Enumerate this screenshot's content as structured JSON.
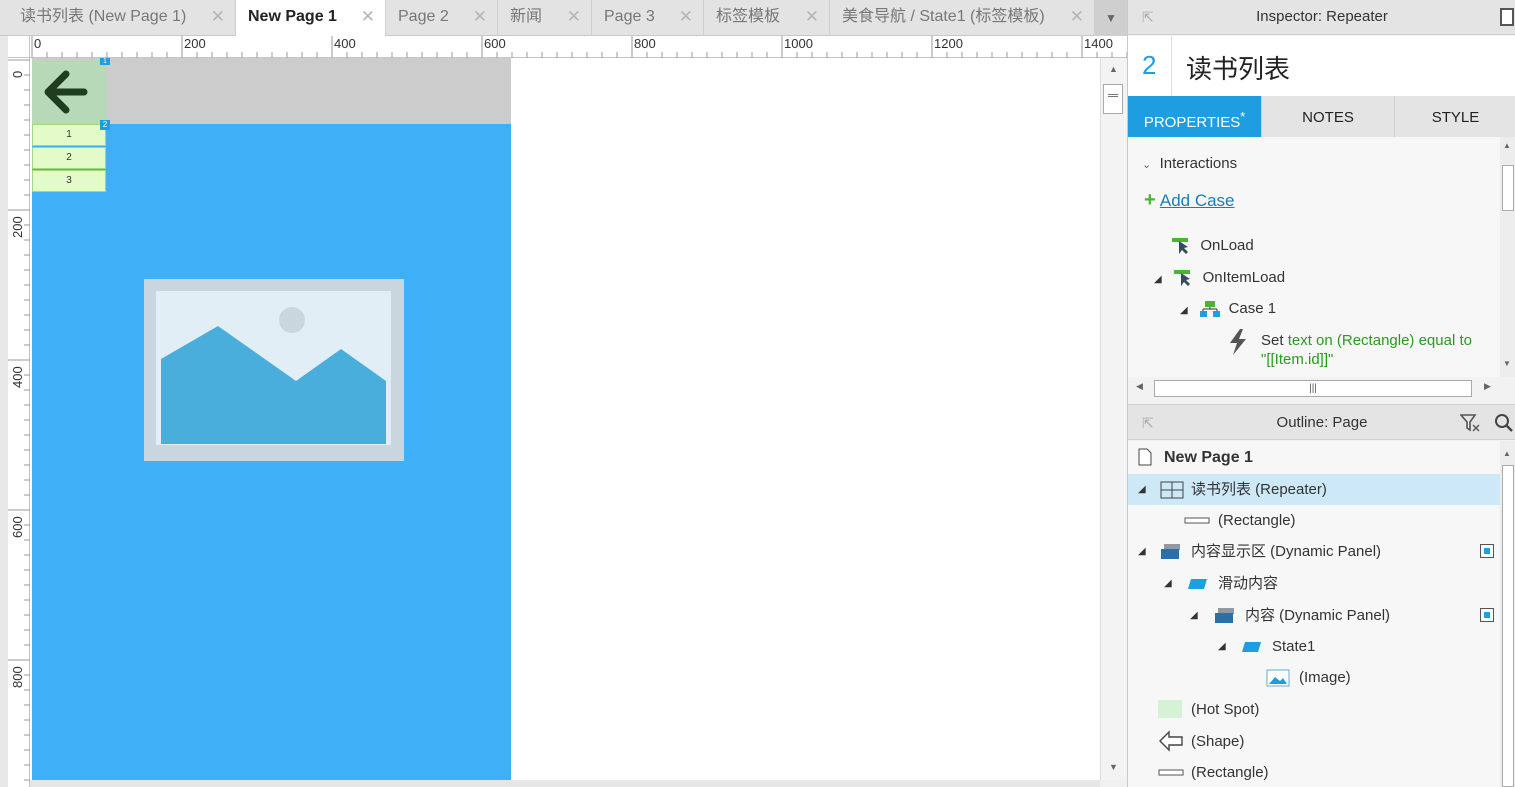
{
  "tabs": [
    {
      "label": "读书列表 (New Page 1)",
      "active": false
    },
    {
      "label": "New Page 1",
      "active": true
    },
    {
      "label": "Page 2",
      "active": false
    },
    {
      "label": "新闻",
      "active": false
    },
    {
      "label": "Page 3",
      "active": false
    },
    {
      "label": "标签模板",
      "active": false
    },
    {
      "label": "美食导航 / State1 (标签模板)",
      "active": false
    }
  ],
  "ruler": {
    "h_labels": [
      "0",
      "200",
      "400",
      "600",
      "800",
      "1000",
      "1200",
      "1400"
    ],
    "v_labels": [
      "0",
      "200",
      "400",
      "600",
      "800"
    ]
  },
  "canvas": {
    "repeater_items": [
      "1",
      "2",
      "3"
    ],
    "badge_top": "1",
    "badge_repeater": "2"
  },
  "inspector": {
    "header": "Inspector: Repeater",
    "count": "2",
    "name": "读书列表",
    "tabs": [
      {
        "label": "PROPERTIES",
        "suffix": "*",
        "active": true
      },
      {
        "label": "NOTES",
        "active": false
      },
      {
        "label": "STYLE",
        "active": false
      }
    ],
    "interactions_label": "Interactions",
    "add_case": "Add Case",
    "events": [
      "OnLoad",
      "OnItemLoad"
    ],
    "case_label": "Case 1",
    "action_prefix": "Set ",
    "action_green": "text on (Rectangle) equal to",
    "action_line2": "\"[[Item.id]]\""
  },
  "outline": {
    "header": "Outline: Page",
    "page": "New Page 1",
    "items": [
      {
        "label": "读书列表 (Repeater)",
        "icon": "repeater-icon"
      },
      {
        "label": "(Rectangle)",
        "icon": "rectangle-icon"
      },
      {
        "label": "内容显示区 (Dynamic Panel)",
        "icon": "dynamic-panel-icon"
      },
      {
        "label": "滑动内容",
        "icon": "state-icon"
      },
      {
        "label": "内容 (Dynamic Panel)",
        "icon": "dynamic-panel-icon"
      },
      {
        "label": "State1",
        "icon": "state-icon"
      },
      {
        "label": "(Image)",
        "icon": "image-icon"
      },
      {
        "label": "(Hot Spot)",
        "icon": "hotspot-icon"
      },
      {
        "label": "(Shape)",
        "icon": "arrow-shape-icon"
      },
      {
        "label": "(Rectangle)",
        "icon": "rectangle-icon"
      }
    ]
  },
  "colors": {
    "accent": "#1e9ee0",
    "canvas_blue": "#3db0f7",
    "header_gray": "#cccccc",
    "repeater_green": "#e3fbc9",
    "action_green": "#2a9a1f"
  }
}
